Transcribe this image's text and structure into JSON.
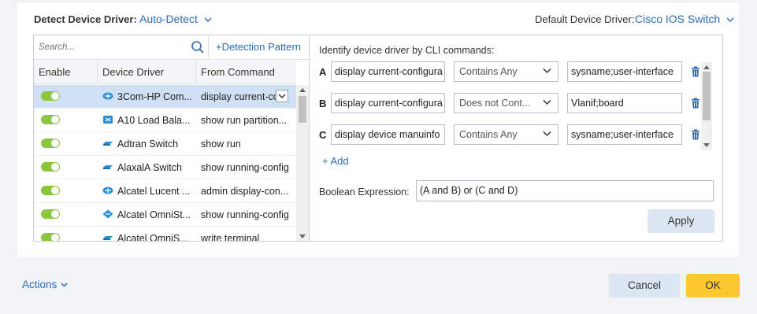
{
  "header": {
    "detect_label": "Detect Device Driver:",
    "detect_value": "Auto-Detect",
    "default_label": "Default Device Driver:",
    "default_value": "Cisco IOS Switch"
  },
  "left": {
    "search_placeholder": "Search...",
    "detection_pattern_link": "+Detection Pattern",
    "columns": [
      "Enable",
      "Device Driver",
      "From Command"
    ],
    "rows": [
      {
        "enabled": true,
        "icon": "router-icon",
        "driver": "3Com-HP Com...",
        "command": "display current-co",
        "selected": true
      },
      {
        "enabled": true,
        "icon": "load-balancer-icon",
        "driver": "A10 Load Bala...",
        "command": "show run partition..."
      },
      {
        "enabled": true,
        "icon": "switch-icon",
        "driver": "Adtran Switch",
        "command": "show run"
      },
      {
        "enabled": true,
        "icon": "switch-icon",
        "driver": "AlaxalA Switch",
        "command": "show running-config"
      },
      {
        "enabled": true,
        "icon": "router-icon",
        "driver": "Alcatel Lucent ...",
        "command": "admin display-con..."
      },
      {
        "enabled": true,
        "icon": "router-icon",
        "driver": "Alcatel OmniSt...",
        "command": "show running-config"
      },
      {
        "enabled": true,
        "icon": "switch-icon",
        "driver": "Alcatel OmniS...",
        "command": "write terminal"
      }
    ]
  },
  "right": {
    "title": "Identify device driver by CLI commands:",
    "conditions": [
      {
        "letter": "A",
        "command": "display current-configura",
        "operator": "Contains Any",
        "value": "sysname;user-interface"
      },
      {
        "letter": "B",
        "command": "display current-configura",
        "operator": "Does not Cont...",
        "value": "Vlanif;board"
      },
      {
        "letter": "C",
        "command": "display device manuinfo",
        "operator": "Contains Any",
        "value": "sysname;user-interface"
      }
    ],
    "add_label": "+ Add",
    "boolean_label": "Boolean Expression:",
    "boolean_value": "(A and B) or (C and D)",
    "apply_label": "Apply"
  },
  "footer": {
    "actions_label": "Actions",
    "cancel_label": "Cancel",
    "ok_label": "OK"
  },
  "colors": {
    "accent": "#2a6db6",
    "toggle_on": "#8cc63f",
    "ok": "#fcc72f",
    "secondary_button": "#dde6f3",
    "selected_row": "#cfe0f4"
  }
}
